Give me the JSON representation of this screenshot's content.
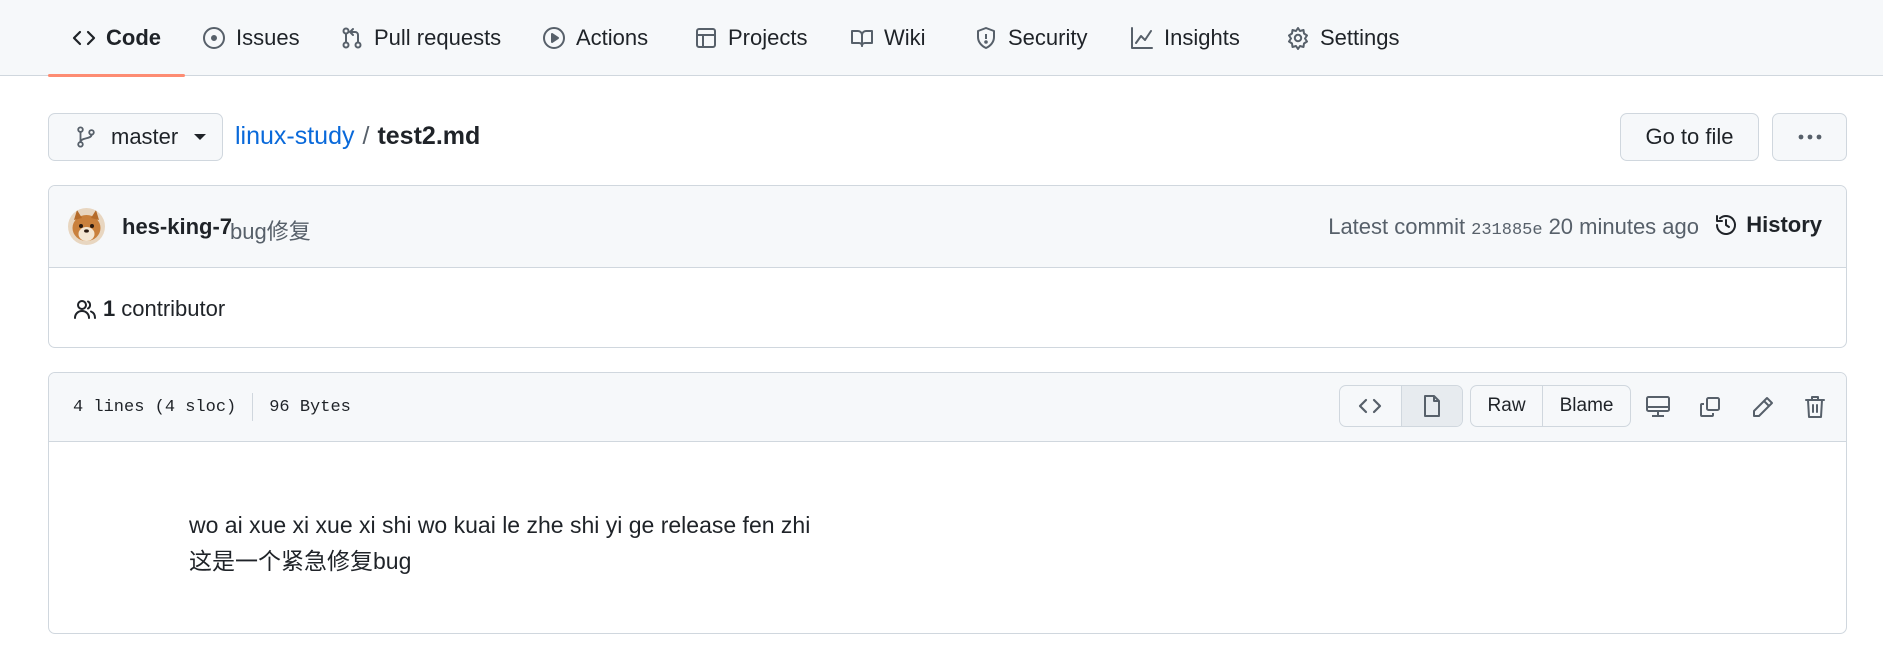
{
  "colors": {
    "accent_underline": "#fd8c73",
    "link": "#0969da",
    "border": "#d0d7de",
    "muted": "#57606a",
    "text": "#1f2328"
  },
  "nav": {
    "items": [
      {
        "label": "Code",
        "icon": "code-icon",
        "selected": true
      },
      {
        "label": "Issues",
        "icon": "issue-opened-icon"
      },
      {
        "label": "Pull requests",
        "icon": "git-pull-request-icon"
      },
      {
        "label": "Actions",
        "icon": "play-icon"
      },
      {
        "label": "Projects",
        "icon": "table-icon"
      },
      {
        "label": "Wiki",
        "icon": "book-icon"
      },
      {
        "label": "Security",
        "icon": "shield-icon"
      },
      {
        "label": "Insights",
        "icon": "graph-icon"
      },
      {
        "label": "Settings",
        "icon": "gear-icon"
      }
    ]
  },
  "branch": {
    "name": "master",
    "icon": "git-branch-icon"
  },
  "breadcrumb": {
    "repo": "linux-study",
    "separator": "/",
    "file": "test2.md"
  },
  "header_buttons": {
    "go_to_file": "Go to file",
    "more": "kebab-horizontal-icon"
  },
  "commit": {
    "author": "hes-king-7",
    "message": "bug修复",
    "latest_label": "Latest commit",
    "sha": "231885e",
    "time": "20 minutes ago",
    "history_label": "History",
    "avatar": "shiba-dog-avatar"
  },
  "contributors": {
    "count": "1",
    "label": "contributor"
  },
  "file": {
    "lines_info": "4 lines (4 sloc)",
    "size": "96 Bytes",
    "raw_label": "Raw",
    "blame_label": "Blame",
    "content": [
      "wo ai xue xi xue xi shi wo kuai le zhe shi yi ge release fen zhi",
      "这是一个紧急修复bug"
    ]
  }
}
